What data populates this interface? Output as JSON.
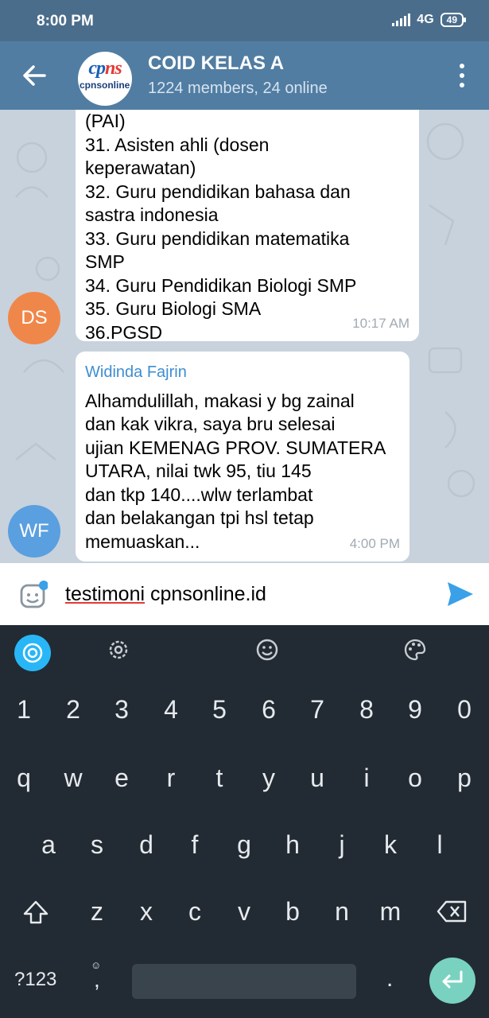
{
  "status_bar": {
    "time": "8:00 PM",
    "network": "4G",
    "battery": "49"
  },
  "header": {
    "title": "COID KELAS A",
    "subtitle": "1224 members, 24 online",
    "logo_top": "cpns",
    "logo_bottom": "cpnsonline.id"
  },
  "messages": [
    {
      "avatar": "DS",
      "text": "(PAI)\n31. Asisten ahli (dosen\nkeperawatan)\n32. Guru pendidikan bahasa dan\nsastra indonesia\n33. Guru pendidikan matematika\nSMP\n34. Guru Pendidikan Biologi SMP\n35. Guru Biologi SMA\n36.PGSD",
      "time": "10:17 AM"
    },
    {
      "avatar": "WF",
      "sender": "Widinda Fajrin",
      "text": "Alhamdulillah, makasi y bg zainal\ndan kak vikra, saya bru selesai\nujian KEMENAG PROV. SUMATERA\nUTARA, nilai twk 95, tiu 145\ndan tkp 140....wlw terlambat\ndan belakangan tpi hsl tetap\nmemuaskan...",
      "time": "4:00 PM"
    }
  ],
  "input": {
    "word1": "testimoni",
    "word2": " cpnsonline.id"
  },
  "keyboard": {
    "numbers": [
      "1",
      "2",
      "3",
      "4",
      "5",
      "6",
      "7",
      "8",
      "9",
      "0"
    ],
    "row1": [
      "q",
      "w",
      "e",
      "r",
      "t",
      "y",
      "u",
      "i",
      "o",
      "p"
    ],
    "row2": [
      "a",
      "s",
      "d",
      "f",
      "g",
      "h",
      "j",
      "k",
      "l"
    ],
    "row3": [
      "z",
      "x",
      "c",
      "v",
      "b",
      "n",
      "m"
    ],
    "symbols": "?123",
    "comma": ",",
    "period": "."
  },
  "colors": {
    "header": "#517da2",
    "status_bar": "#4b6d8c",
    "link": "#3e8ed0",
    "keyboard_bg": "#222b33",
    "enter": "#79d2c0"
  }
}
